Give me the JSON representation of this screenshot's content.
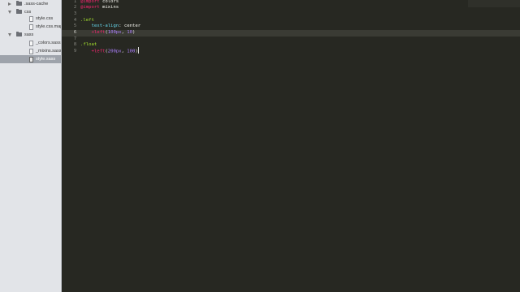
{
  "sidebar": {
    "items": [
      {
        "label": ".sass-cache",
        "type": "folder",
        "expanded": false,
        "icon": "folder-icon",
        "indent": 0
      },
      {
        "label": "css",
        "type": "folder",
        "expanded": true,
        "icon": "folder-icon",
        "indent": 0
      },
      {
        "label": "style.css",
        "type": "file",
        "icon": "file-icon",
        "indent": 1
      },
      {
        "label": "style.css.map",
        "type": "file",
        "icon": "file-icon",
        "indent": 1
      },
      {
        "label": "sass",
        "type": "folder",
        "expanded": true,
        "icon": "folder-icon",
        "indent": 0
      },
      {
        "label": "_colors.sass",
        "type": "file",
        "icon": "file-icon",
        "indent": 1
      },
      {
        "label": "_mixins.sass",
        "type": "file",
        "icon": "file-icon",
        "indent": 1
      },
      {
        "label": "style.sass",
        "type": "file",
        "icon": "file-icon",
        "indent": 1,
        "selected": true
      }
    ]
  },
  "editor": {
    "current_line": 6,
    "lines": [
      {
        "num": "1",
        "tokens": [
          {
            "t": "@import",
            "c": "kw"
          },
          {
            "t": " colors",
            "c": "plain"
          }
        ]
      },
      {
        "num": "2",
        "tokens": [
          {
            "t": "@import",
            "c": "kw"
          },
          {
            "t": " mixins",
            "c": "plain"
          }
        ]
      },
      {
        "num": "3",
        "tokens": []
      },
      {
        "num": "4",
        "tokens": [
          {
            "t": ".left",
            "c": "sel"
          }
        ]
      },
      {
        "num": "5",
        "tokens": [
          {
            "t": "    ",
            "c": "plain"
          },
          {
            "t": "text-align",
            "c": "prop"
          },
          {
            "t": ": center",
            "c": "plain"
          }
        ]
      },
      {
        "num": "6",
        "tokens": [
          {
            "t": "    ",
            "c": "plain"
          },
          {
            "t": "+left",
            "c": "kw"
          },
          {
            "t": "(",
            "c": "plain"
          },
          {
            "t": "100px",
            "c": "num"
          },
          {
            "t": ", ",
            "c": "plain"
          },
          {
            "t": "10",
            "c": "num"
          },
          {
            "t": ")",
            "c": "plain"
          }
        ]
      },
      {
        "num": "7",
        "tokens": []
      },
      {
        "num": "8",
        "tokens": [
          {
            "t": ".float",
            "c": "sel"
          }
        ]
      },
      {
        "num": "9",
        "tokens": [
          {
            "t": "    ",
            "c": "plain"
          },
          {
            "t": "+left",
            "c": "kw"
          },
          {
            "t": "(",
            "c": "plain"
          },
          {
            "t": "200px",
            "c": "num"
          },
          {
            "t": ", ",
            "c": "plain"
          },
          {
            "t": "100",
            "c": "num"
          },
          {
            "t": ")",
            "c": "plain"
          }
        ],
        "cursor": true
      }
    ]
  },
  "colors": {
    "editor_bg": "#272822",
    "sidebar_bg": "#e2e4e8",
    "keyword": "#f92672",
    "selector": "#a6e22e",
    "property": "#66d9ef",
    "number": "#ae81ff"
  }
}
